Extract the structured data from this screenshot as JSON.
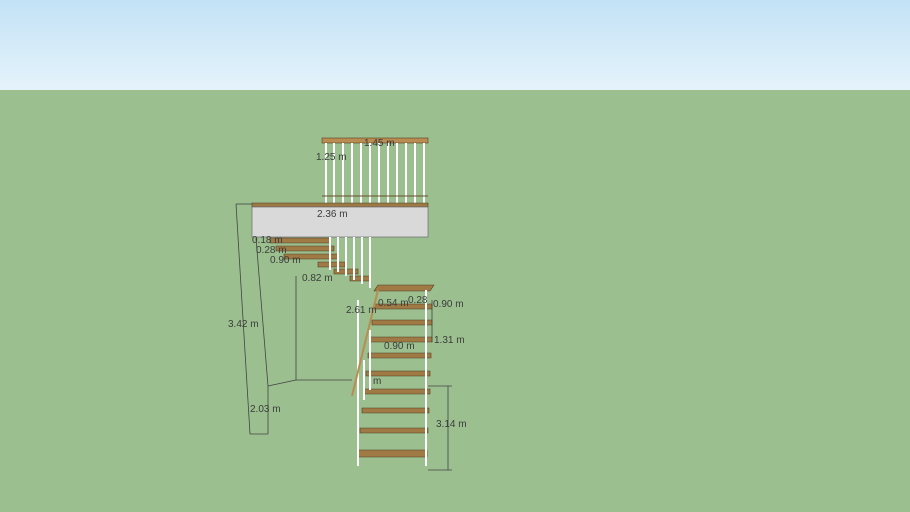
{
  "scene": {
    "sky_color": "#d6ecf8",
    "ground_color": "#9bbf8f",
    "tread_color": "#a07a45",
    "landing_color": "#d9d9d9"
  },
  "dimensions": {
    "railing_width": "1.45 m",
    "railing_height": "1.25 m",
    "landing_width": "2.36 m",
    "total_height": "3.42 m",
    "riser_a": "0.18 m",
    "tread_depth": "0.28 m",
    "upper_flight_width": "0.90 m",
    "offset": "0.82 m",
    "lower_flight_length": "2.61 m",
    "landing_depth": "0.90 m",
    "lower_flight_width": "0.90 m",
    "lower_height": "1.31 m",
    "base_depth": "2.03 m",
    "lower_rise": "3.14 m",
    "small_a": "0.28",
    "small_b": "0.9",
    "small_c": "m",
    "small_d": "0.54 m"
  }
}
